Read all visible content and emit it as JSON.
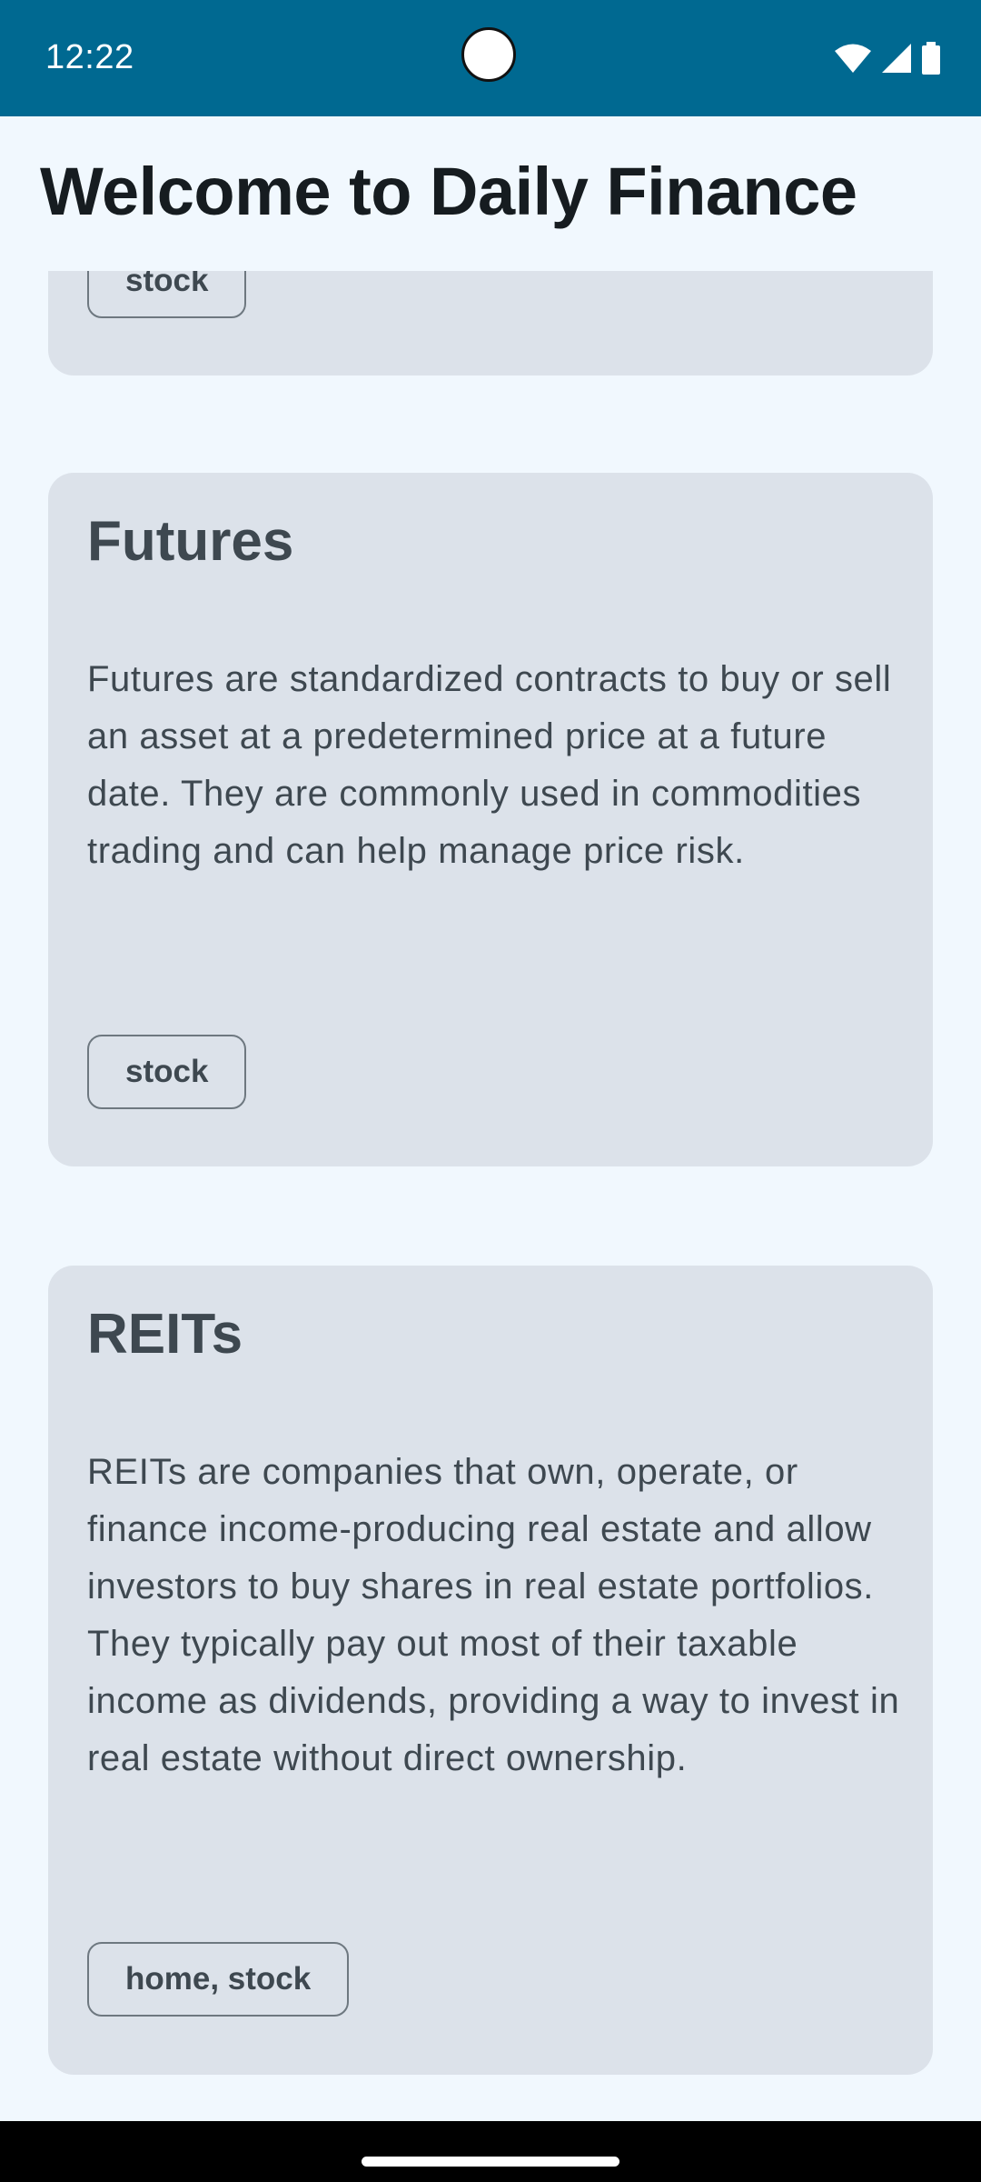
{
  "status_bar": {
    "time": "12:22",
    "background": "#006991"
  },
  "header": {
    "title": "Welcome to Daily Finance"
  },
  "cards": [
    {
      "title": "",
      "description": "",
      "tag": "stock"
    },
    {
      "title": "Futures",
      "description": "Futures are standardized contracts to buy or sell an asset at a predetermined price at a future date. They are commonly used in commodities trading and can help manage price risk.",
      "tag": "stock"
    },
    {
      "title": "REITs",
      "description": "REITs are companies that own, operate, or finance income-producing real estate and allow investors to buy shares in real estate portfolios. They typically pay out most of their taxable income as dividends, providing a way to invest in real estate without direct ownership.",
      "tag": "home, stock"
    }
  ],
  "icons": [
    "wifi-icon",
    "cellular-signal-icon",
    "battery-icon"
  ],
  "colors": {
    "page_bg": "#f1f8fe",
    "card_bg": "#dce2ea",
    "text": "#3e4850",
    "title": "#161c20"
  }
}
